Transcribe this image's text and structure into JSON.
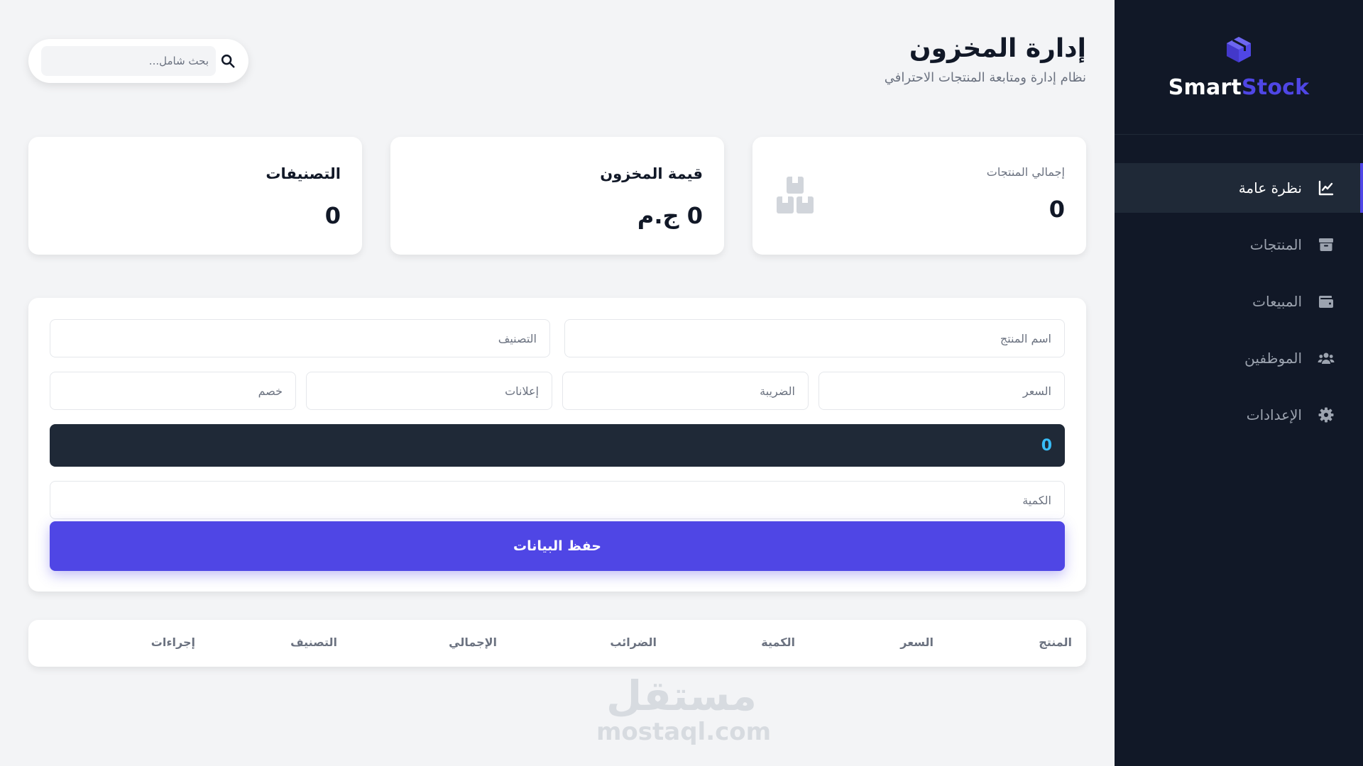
{
  "brand": {
    "part1": "Smart",
    "part2": "Stock"
  },
  "sidebar": {
    "items": [
      {
        "label": "نظرة عامة",
        "icon": "chart-line-icon",
        "active": true
      },
      {
        "label": "المنتجات",
        "icon": "box-icon",
        "active": false
      },
      {
        "label": "المبيعات",
        "icon": "wallet-icon",
        "active": false
      },
      {
        "label": "الموظفين",
        "icon": "users-icon",
        "active": false
      },
      {
        "label": "الإعدادات",
        "icon": "gear-icon",
        "active": false
      }
    ]
  },
  "header": {
    "title": "إدارة المخزون",
    "subtitle": "نظام إدارة ومتابعة المنتجات الاحترافي"
  },
  "search": {
    "placeholder": "بحث شامل..."
  },
  "stats": {
    "products": {
      "label": "إجمالي المنتجات",
      "value": "0"
    },
    "stock_value": {
      "label": "قيمة المخزون",
      "value": "0 ج.م"
    },
    "categories": {
      "label": "التصنيفات",
      "value": "0"
    }
  },
  "form": {
    "product_name_placeholder": "اسم المنتج",
    "category_placeholder": "التصنيف",
    "price_placeholder": "السعر",
    "tax_placeholder": "الضريبة",
    "ads_placeholder": "إعلانات",
    "discount_placeholder": "خصم",
    "total": "0",
    "quantity_placeholder": "الكمية",
    "save_label": "حفظ البيانات"
  },
  "table": {
    "columns": [
      "المنتج",
      "السعر",
      "الكمية",
      "الضرائب",
      "الإجمالي",
      "التصنيف",
      "إجراءات"
    ]
  },
  "watermark": {
    "arabic": "مستقل",
    "latin": "mostaql.com"
  },
  "colors": {
    "sidebar_bg": "#111827",
    "accent": "#4f46e5",
    "page_bg": "#f3f4f6",
    "total_bar_bg": "#1f2937",
    "total_text": "#38bdf8"
  }
}
